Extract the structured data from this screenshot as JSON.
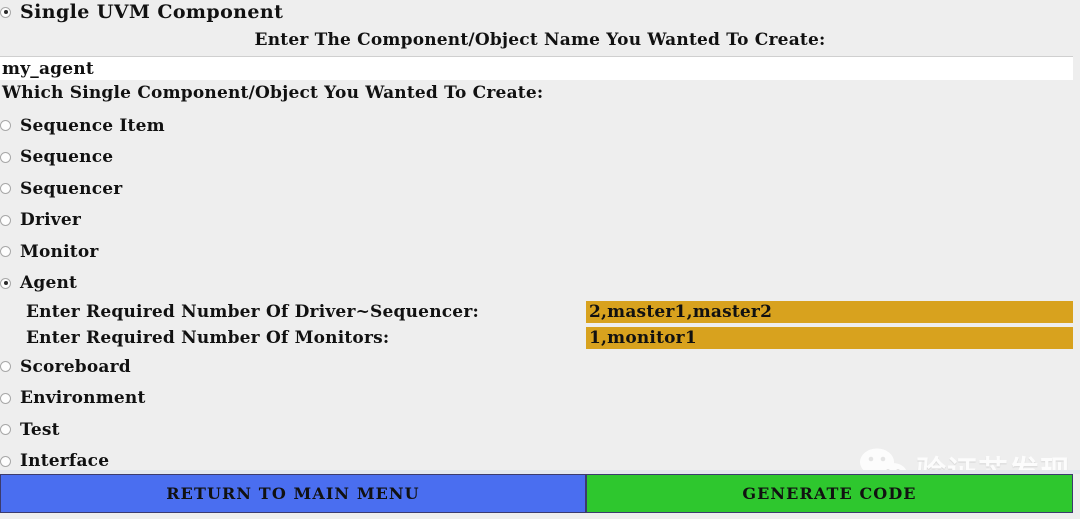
{
  "window": {
    "title": "Single UVM Component",
    "title_selected": true
  },
  "form": {
    "name_prompt": "Enter The Component/Object Name You Wanted To Create:",
    "name_value": "my_agent",
    "name_placeholder": "",
    "question": "Which Single Component/Object You Wanted To Create:"
  },
  "options": [
    {
      "label": "Sequence Item",
      "selected": false
    },
    {
      "label": "Sequence",
      "selected": false
    },
    {
      "label": "Sequencer",
      "selected": false
    },
    {
      "label": "Driver",
      "selected": false
    },
    {
      "label": "Monitor",
      "selected": false
    },
    {
      "label": "Agent",
      "selected": true
    },
    {
      "label": "Scoreboard",
      "selected": false
    },
    {
      "label": "Environment",
      "selected": false
    },
    {
      "label": "Test",
      "selected": false
    },
    {
      "label": "Interface",
      "selected": false
    }
  ],
  "agent_fields": [
    {
      "label": "Enter Required Number Of Driver~Sequencer:",
      "value": "2,master1,master2"
    },
    {
      "label": "Enter Required Number Of Monitors:",
      "value": "1,monitor1"
    }
  ],
  "footer": {
    "return_label": "RETURN TO MAIN MENU",
    "generate_label": "GENERATE CODE"
  },
  "watermark": {
    "text": "验证芯发现",
    "logo": "wechat-icon"
  },
  "colors": {
    "background": "#eeeeee",
    "input_field": "#ffffff",
    "agent_field": "#d8a21e",
    "return_button": "#4a6ef0",
    "generate_button": "#2ec72e",
    "text": "#111111"
  }
}
